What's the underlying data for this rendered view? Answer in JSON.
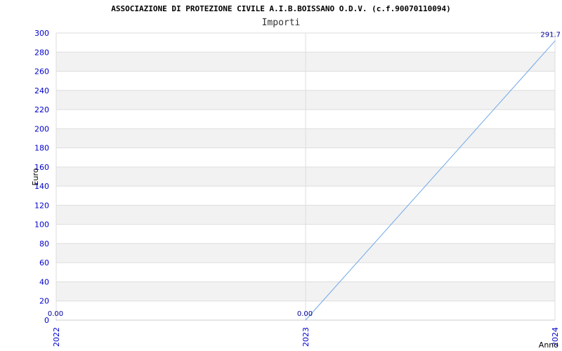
{
  "title": "ASSOCIAZIONE DI PROTEZIONE CIVILE A.I.B.BOISSANO O.D.V. (c.f.90070110094)",
  "subtitle": "Importi",
  "colors": {
    "line": "#6fa8e8",
    "band": "#f2f2f2",
    "grid": "#dddddd",
    "tick": "#0000cc"
  },
  "chart_data": {
    "type": "line",
    "title": "ASSOCIAZIONE DI PROTEZIONE CIVILE A.I.B.BOISSANO O.D.V. (c.f.90070110094)",
    "subtitle": "Importi",
    "xlabel": "Anno",
    "ylabel": "Euro",
    "x": [
      "2022",
      "2023",
      "2024"
    ],
    "series": [
      {
        "values": [
          0,
          0,
          291.7
        ],
        "labels": [
          "0.00",
          "0.00",
          "291.7"
        ]
      }
    ],
    "ylim": [
      0,
      300
    ],
    "yticks": [
      0,
      20,
      40,
      60,
      80,
      100,
      120,
      140,
      160,
      180,
      200,
      220,
      240,
      260,
      280,
      300
    ],
    "grid": true,
    "legend": "none"
  }
}
